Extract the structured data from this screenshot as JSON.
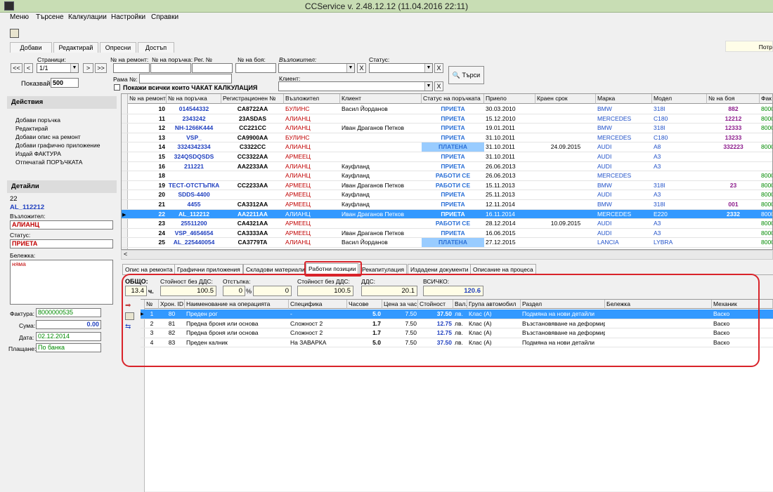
{
  "window": {
    "title": "CCService v. 2.48.12.12 (11.04.2016 22:11)"
  },
  "menu": [
    "Меню",
    "Търсене",
    "Калкулации",
    "Настройки",
    "Справки"
  ],
  "toolbar_tabs": [
    "Добави",
    "Редактирай",
    "Опресни",
    "Достъп"
  ],
  "right_label": "Потр",
  "filters": {
    "pages_label": "Страници:",
    "page_value": "1/1",
    "nav_first": "<<",
    "nav_prev": "<",
    "nav_next": ">",
    "nav_last": ">>",
    "show_label": "Показвай",
    "show_value": "500",
    "repair_no_label": "№ на ремонт:",
    "order_no_label": "№ на поръчка:",
    "reg_no_label": "Рег. №",
    "paint_no_label": "№ на боя:",
    "assignor_label": "Възложител:",
    "status_label": "Статус:",
    "frame_label": "Рама №:",
    "client_label": "Клиент:",
    "waiting_checkbox": "Покажи всички които ЧАКАТ КАЛКУЛАЦИЯ",
    "clear": "X",
    "search_button": "Търси"
  },
  "left": {
    "actions_title": "Действия",
    "actions": [
      "Добави поръчка",
      "Редактирай",
      "Добави опис на ремонт",
      "Добави графично приложение",
      "Издай ФАКТУРА",
      "Отпечатай ПОРЪЧКАТА"
    ],
    "details_title": "Детайли",
    "detail_no": "22",
    "detail_order": "AL_112212",
    "assignor_label": "Възложител:",
    "assignor_value": "АЛИАНЦ",
    "status_label": "Статус:",
    "status_value": "ПРИЕТА",
    "note_label": "Бележка:",
    "note_value": "няма",
    "invoice_label": "Фактура:",
    "invoice_value": "8000000535",
    "sum_label": "Сума:",
    "sum_value": "0.00",
    "date_label": "Дата:",
    "date_value": "02.12.2014",
    "payment_label": "Плащане:",
    "payment_value": "По банка"
  },
  "grid": {
    "headers": [
      "№ на ремонт",
      "№ на поръчка",
      "Регистрационен №",
      "Възложител",
      "Клиент",
      "Статус на поръчката",
      "Приело",
      "Краен срок",
      "Марка",
      "Модел",
      "№ на боя",
      "Фак"
    ],
    "rows": [
      [
        "10",
        "014544332",
        "CA8722AA",
        "БУЛИНС",
        "Васил Йорданов",
        "ПРИЕТА",
        "30.03.2010",
        "",
        "BMW",
        "318I",
        "882",
        "8000"
      ],
      [
        "11",
        "2343242",
        "23ASDAS",
        "АЛИАНЦ",
        "",
        "ПРИЕТА",
        "15.12.2010",
        "",
        "MERCEDES",
        "C180",
        "12212",
        "8000"
      ],
      [
        "12",
        "NH-1266K444",
        "CC221CC",
        "АЛИАНЦ",
        "Иван Драганов Петков",
        "ПРИЕТА",
        "19.01.2011",
        "",
        "BMW",
        "318I",
        "12333",
        "8000"
      ],
      [
        "13",
        "VSP_",
        "CA9900AA",
        "БУЛИНС",
        "",
        "ПРИЕТА",
        "31.10.2011",
        "",
        "MERCEDES",
        "C180",
        "13233",
        ""
      ],
      [
        "14",
        "3324342334",
        "C3322CC",
        "АЛИАНЦ",
        "",
        "ПЛАТЕНА",
        "31.10.2011",
        "24.09.2015",
        "AUDI",
        "A8",
        "332223",
        "8000"
      ],
      [
        "15",
        "324QSDQSDS",
        "CC3322AA",
        "АРМЕЕЦ",
        "",
        "ПРИЕТА",
        "31.10.2011",
        "",
        "AUDI",
        "A3",
        "",
        ""
      ],
      [
        "16",
        "211221",
        "AA2233AA",
        "АЛИАНЦ",
        "Кауфланд",
        "ПРИЕТА",
        "26.06.2013",
        "",
        "AUDI",
        "A3",
        "",
        ""
      ],
      [
        "18",
        "",
        "",
        "АЛИАНЦ",
        "Кауфланд",
        "РАБОТИ СЕ",
        "26.06.2013",
        "",
        "MERCEDES",
        "",
        "",
        "8000"
      ],
      [
        "19",
        "ТЕСТ-ОТСТЪПКА",
        "CC2233AA",
        "АРМЕЕЦ",
        "Иван Драганов Петков",
        "РАБОТИ СЕ",
        "15.11.2013",
        "",
        "BMW",
        "318I",
        "23",
        "8000"
      ],
      [
        "20",
        "SDDS-4400",
        "",
        "АРМЕЕЦ",
        "Кауфланд",
        "ПРИЕТА",
        "25.11.2013",
        "",
        "AUDI",
        "A3",
        "",
        "8000"
      ],
      [
        "21",
        "4455",
        "CA3312AA",
        "АРМЕЕЦ",
        "Кауфланд",
        "ПРИЕТА",
        "12.11.2014",
        "",
        "BMW",
        "318I",
        "001",
        "8000"
      ],
      [
        "22",
        "AL_112212",
        "AA2211AA",
        "АЛИАНЦ",
        "Иван Драганов Петков",
        "ПРИЕТА",
        "16.11.2014",
        "",
        "MERCEDES",
        "E220",
        "2332",
        "8000"
      ],
      [
        "23",
        "25511200",
        "CA4321AA",
        "АРМЕЕЦ",
        "",
        "РАБОТИ СЕ",
        "28.12.2014",
        "10.09.2015",
        "AUDI",
        "A3",
        "",
        "8000"
      ],
      [
        "24",
        "VSP_4654654",
        "CA3333AA",
        "АРМЕЕЦ",
        "Иван Драганов Петков",
        "ПРИЕТА",
        "16.06.2015",
        "",
        "AUDI",
        "A3",
        "",
        "8000"
      ],
      [
        "25",
        "AL_225440054",
        "CA3779TA",
        "АЛИАНЦ",
        "Васил Йорданов",
        "ПЛАТЕНА",
        "27.12.2015",
        "",
        "LANCIA",
        "LYBRA",
        "",
        "8000"
      ]
    ],
    "selected_index": 11
  },
  "subtabs": [
    "Опис на ремонта",
    "Графични приложения",
    "Складови материали",
    "Работни позиции",
    "Рекапитулация",
    "Издадени документи",
    "Описание на процеса"
  ],
  "active_subtab": 3,
  "totals": {
    "total_label": "ОБЩО:",
    "hours_value": "13.4",
    "hours_unit": "ч.",
    "net_label": "Стойност без ДДС:",
    "net_value": "100.5",
    "discount_label": "Отстъпка:",
    "discount_pct": "0",
    "pct_sign": "%",
    "discount_value": "0",
    "net2_label": "Стойност без ДДС:",
    "net2_value": "100.5",
    "vat_label": "ДДС:",
    "vat_value": "20.1",
    "all_label": "ВСИЧКО:",
    "all_value": "120.6"
  },
  "positions": {
    "headers": [
      "№",
      "Хрон. ID",
      "Наименование на операцията",
      "Специфика",
      "Часове",
      "Цена за час",
      "Стойност",
      "Вал.",
      "Група автомобил",
      "Раздел",
      "Бележка",
      "Механик"
    ],
    "rows": [
      [
        "1",
        "80",
        "Преден рог",
        "-",
        "5.0",
        "7.50",
        "37.50",
        "лв.",
        "Клас (A)",
        "Подмяна на нови детайли",
        "",
        "Васко"
      ],
      [
        "2",
        "81",
        "Предна броня или основа",
        "Сложност 2",
        "1.7",
        "7.50",
        "12.75",
        "лв.",
        "Клас (A)",
        "Възстановяване на деформир",
        "",
        "Васко"
      ],
      [
        "3",
        "82",
        "Предна броня или основа",
        "Сложност 2",
        "1.7",
        "7.50",
        "12.75",
        "лв.",
        "Клас (A)",
        "Възстановяване на деформир",
        "",
        "Васко"
      ],
      [
        "4",
        "83",
        "Преден калник",
        "На ЗАВАРКА",
        "5.0",
        "7.50",
        "37.50",
        "лв.",
        "Клас (A)",
        "Подмяна на нови детайли",
        "",
        "Васко"
      ]
    ],
    "selected_index": 0
  },
  "colors": {
    "accent_red": "#d9232a",
    "assignor_red": "#c00000",
    "order_blue": "#1f3fbf",
    "status_blue": "#2a6fd6",
    "paid_bg": "#99ccff",
    "brand_blue": "#1f50c8",
    "paint_purple": "#8b1a8b",
    "invoice_green": "#008a00",
    "selection": "#3399ff"
  }
}
